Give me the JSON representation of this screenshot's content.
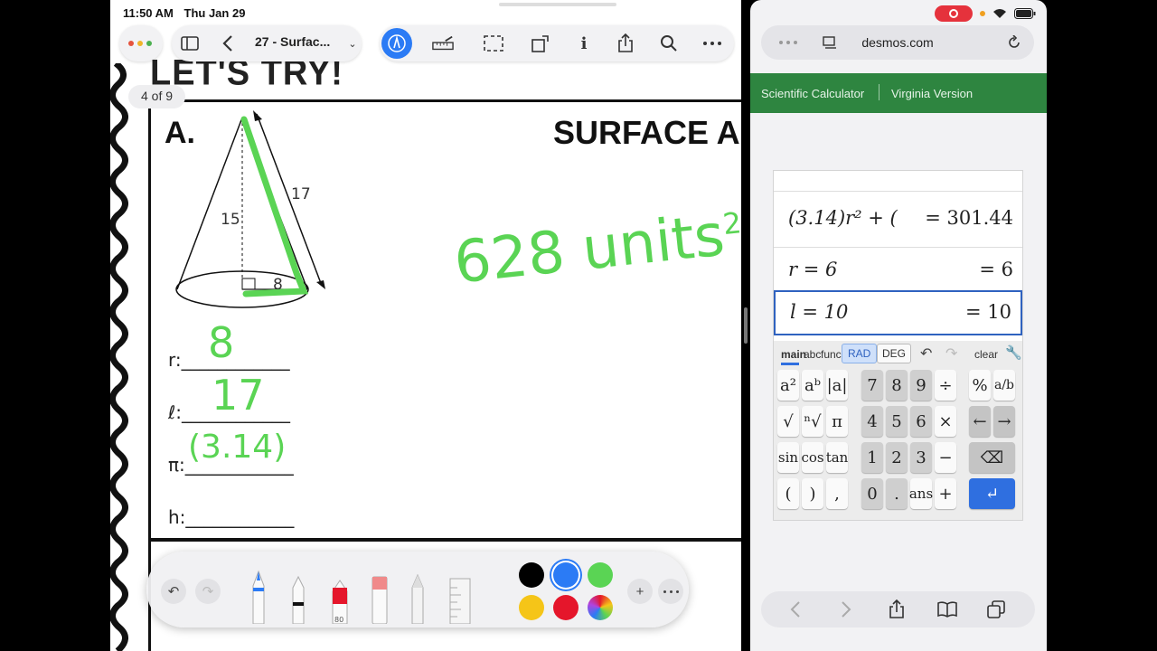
{
  "status": {
    "time": "11:50 AM",
    "date": "Thu Jan 29"
  },
  "goodnotes": {
    "doc_title": "27 - Surfac...",
    "page_counter": "4 of 9",
    "heading": "LET'S TRY!",
    "problem_label": "A.",
    "section_title": "SURFACE ARE",
    "bottom_title_fragment": "ARE",
    "cone": {
      "slant": "17",
      "height": "15",
      "radius": "8"
    },
    "blanks": {
      "r": "r:____________",
      "l": "ℓ:____________",
      "pi": "π:____________",
      "h": "h:____________"
    },
    "handwriting": {
      "r_value": "8",
      "l_value": "17",
      "pi_value": "(3.14)",
      "answer": "628 units",
      "answer_exp": "2"
    },
    "palette": {
      "colors": [
        "#000000",
        "#2b7bf5",
        "#5ad454",
        "#f5c518",
        "#e5162b",
        "rainbow"
      ],
      "selected": "#2b7bf5",
      "marker_number": "80"
    }
  },
  "safari": {
    "url": "desmos.com",
    "nav_links": [
      "Scientific Calculator",
      "Virginia Version"
    ]
  },
  "desmos": {
    "expressions": [
      {
        "lhs": "(3.14)r² + (",
        "rhs": "= 301.44"
      },
      {
        "lhs": "r = 6",
        "rhs": "= 6"
      },
      {
        "lhs": "l = 10",
        "rhs": "= 10"
      }
    ],
    "tabs": [
      "main",
      "abc",
      "func"
    ],
    "modes": [
      "RAD",
      "DEG"
    ],
    "clear": "clear",
    "keys": {
      "row1": [
        "a²",
        "aᵇ",
        "|a|",
        "7",
        "8",
        "9",
        "÷",
        "%",
        "a/b"
      ],
      "row2": [
        "√",
        "ⁿ√",
        "π",
        "4",
        "5",
        "6",
        "×",
        "←",
        "→"
      ],
      "row3": [
        "sin",
        "cos",
        "tan",
        "1",
        "2",
        "3",
        "−",
        "⌫"
      ],
      "row4": [
        "(",
        ")",
        ",",
        "0",
        ".",
        "ans",
        "+",
        "↵"
      ]
    }
  }
}
